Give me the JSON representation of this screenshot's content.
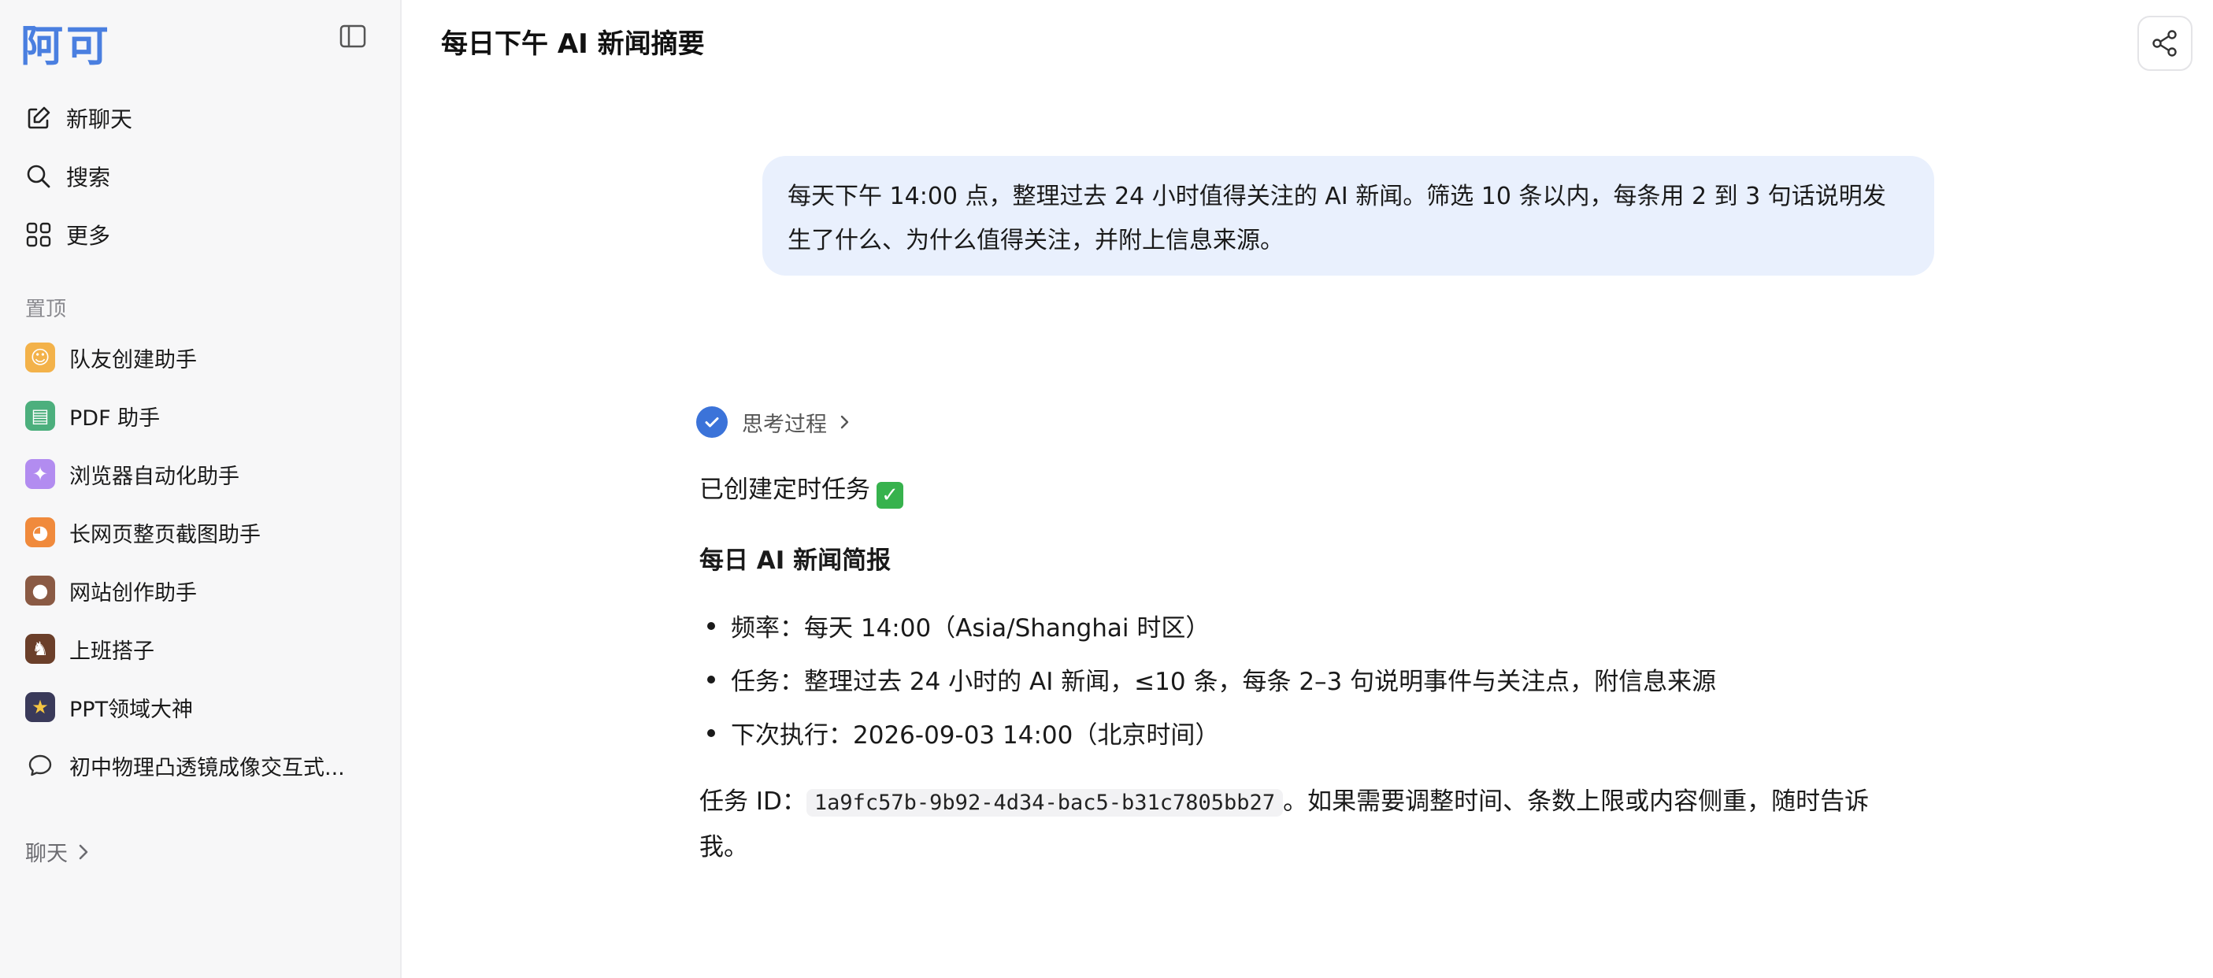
{
  "sidebar": {
    "logo": "阿可",
    "nav": [
      {
        "label": "新聊天",
        "icon": "edit-icon"
      },
      {
        "label": "搜索",
        "icon": "search-icon"
      },
      {
        "label": "更多",
        "icon": "grid-icon"
      }
    ],
    "pinned_label": "置顶",
    "pinned": [
      {
        "label": "队友创建助手",
        "icon": "teammate-emoji-icon",
        "color": "#f3b24a"
      },
      {
        "label": "PDF 助手",
        "icon": "pdf-emoji-icon",
        "color": "#4caf7d"
      },
      {
        "label": "浏览器自动化助手",
        "icon": "unicorn-emoji-icon",
        "color": "#b28cf0"
      },
      {
        "label": "长网页整页截图助手",
        "icon": "cat-emoji-icon",
        "color": "#f08a3c"
      },
      {
        "label": "网站创作助手",
        "icon": "monkey-emoji-icon",
        "color": "#8a5a44"
      },
      {
        "label": "上班搭子",
        "icon": "horse-emoji-icon",
        "color": "#6b3f2a"
      },
      {
        "label": "PPT领域大神",
        "icon": "star-emoji-icon",
        "color": "#3a3a5a"
      },
      {
        "label": "初中物理凸透镜成像交互式...",
        "icon": "chat-bubble-icon",
        "color": ""
      }
    ],
    "chat_label": "聊天"
  },
  "header": {
    "title": "每日下午 AI 新闻摘要"
  },
  "user_message": "每天下午 14:00 点，整理过去 24 小时值得关注的 AI 新闻。筛选 10 条以内，每条用 2 到 3 句话说明发生了什么、为什么值得关注，并附上信息来源。",
  "assistant": {
    "thinking_label": "思考过程",
    "created_text": "已创建定时任务",
    "heading": "每日 AI 新闻简报",
    "bullets": [
      "频率：每天 14:00（Asia/Shanghai 时区）",
      "任务：整理过去 24 小时的 AI 新闻，≤10 条，每条 2–3 句说明事件与关注点，附信息来源",
      "下次执行：2026-09-03 14:00（北京时间）"
    ],
    "task_id_prefix": "任务 ID：",
    "task_id": "1a9fc57b-9b92-4d34-bac5-b31c7805bb27",
    "task_id_suffix": "。如果需要调整时间、条数上限或内容侧重，随时告诉我。"
  },
  "colors": {
    "accent": "#4a7fe0",
    "user_bubble": "#e9f0fd",
    "check": "#3b73d9"
  }
}
